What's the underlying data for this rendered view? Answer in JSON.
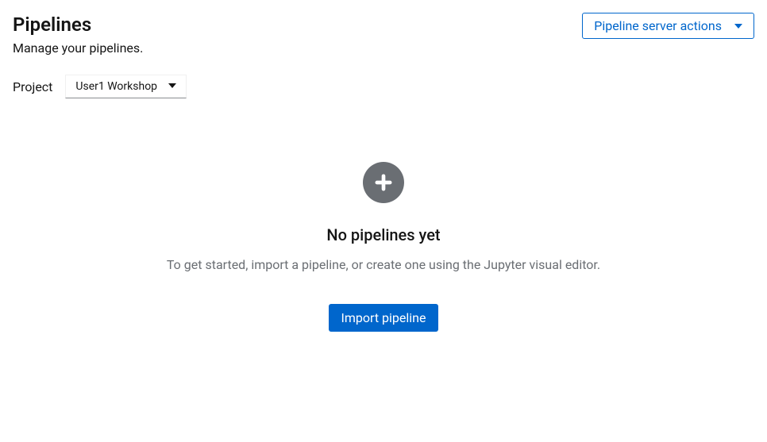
{
  "header": {
    "title": "Pipelines",
    "subtitle": "Manage your pipelines.",
    "server_actions_label": "Pipeline server actions"
  },
  "project": {
    "label": "Project",
    "selected": "User1 Workshop"
  },
  "empty_state": {
    "title": "No pipelines yet",
    "description": "To get started, import a pipeline, or create one using the Jupyter visual editor.",
    "import_button": "Import pipeline"
  },
  "icons": {
    "plus": "plus-circle-icon",
    "caret": "caret-down-icon"
  },
  "colors": {
    "primary": "#0066cc",
    "muted": "#6a6e73"
  }
}
